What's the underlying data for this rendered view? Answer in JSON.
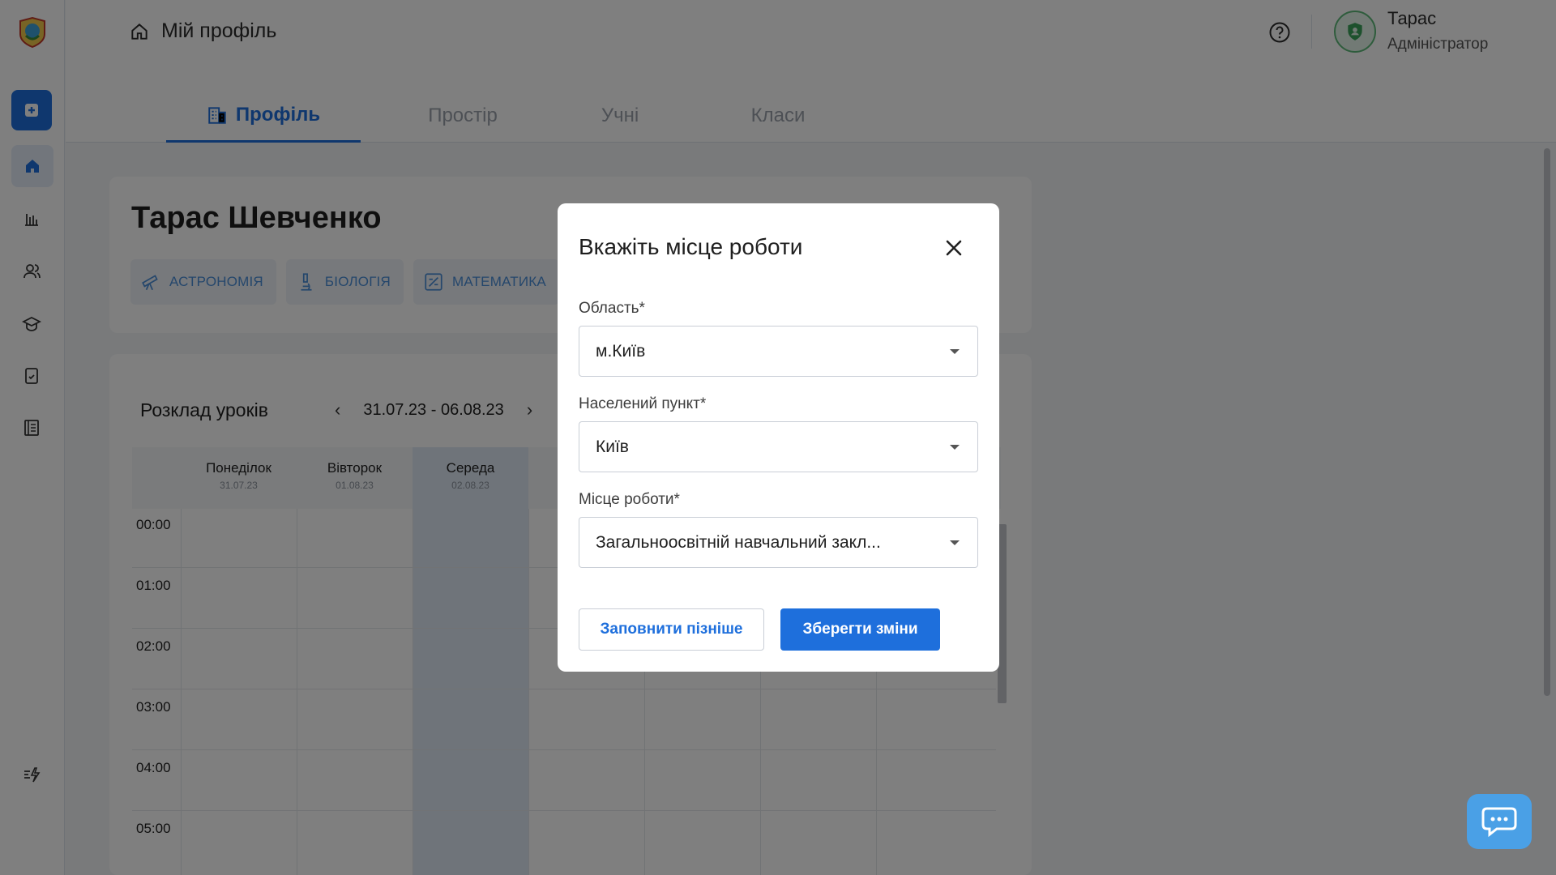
{
  "header": {
    "title": "Мій профіль",
    "user_name": "Тарас",
    "user_role": "Адміністратор"
  },
  "tabs": [
    {
      "label": "Профіль",
      "active": true
    },
    {
      "label": "Простір",
      "active": false
    },
    {
      "label": "Учні",
      "active": false
    },
    {
      "label": "Класи",
      "active": false
    }
  ],
  "sidebar": {
    "items": [
      "add-icon",
      "home-icon",
      "chart-icon",
      "users-icon",
      "graduation-cap-icon",
      "document-check-icon",
      "book-icon",
      "quick-action-icon"
    ]
  },
  "profile": {
    "name": "Тарас Шевченко",
    "subjects": [
      "АСТРОНОМІЯ",
      "БІОЛОГІЯ",
      "МАТЕМАТИКА"
    ]
  },
  "schedule": {
    "title": "Розклад уроків",
    "week": "31.07.23 - 06.08.23",
    "days": [
      {
        "name": "Понеділок",
        "date": "31.07.23"
      },
      {
        "name": "Вівторок",
        "date": "01.08.23"
      },
      {
        "name": "Середа",
        "date": "02.08.23"
      }
    ],
    "times": [
      "00:00",
      "01:00",
      "02:00",
      "03:00",
      "04:00",
      "05:00"
    ]
  },
  "modal": {
    "title": "Вкажіть місце роботи",
    "region_label": "Область*",
    "region_value": "м.Київ",
    "city_label": "Населений пункт*",
    "city_value": "Київ",
    "workplace_label": "Місце роботи*",
    "workplace_value": "Загальноосвітній навчальний закл...",
    "later_button": "Заповнити пізніше",
    "save_button": "Зберегти зміни"
  },
  "colors": {
    "accent": "#1e6fdc",
    "overlay": "rgba(0,0,0,0.5)",
    "chat": "#4aa0e6",
    "avatar_ring": "#5cb878"
  }
}
